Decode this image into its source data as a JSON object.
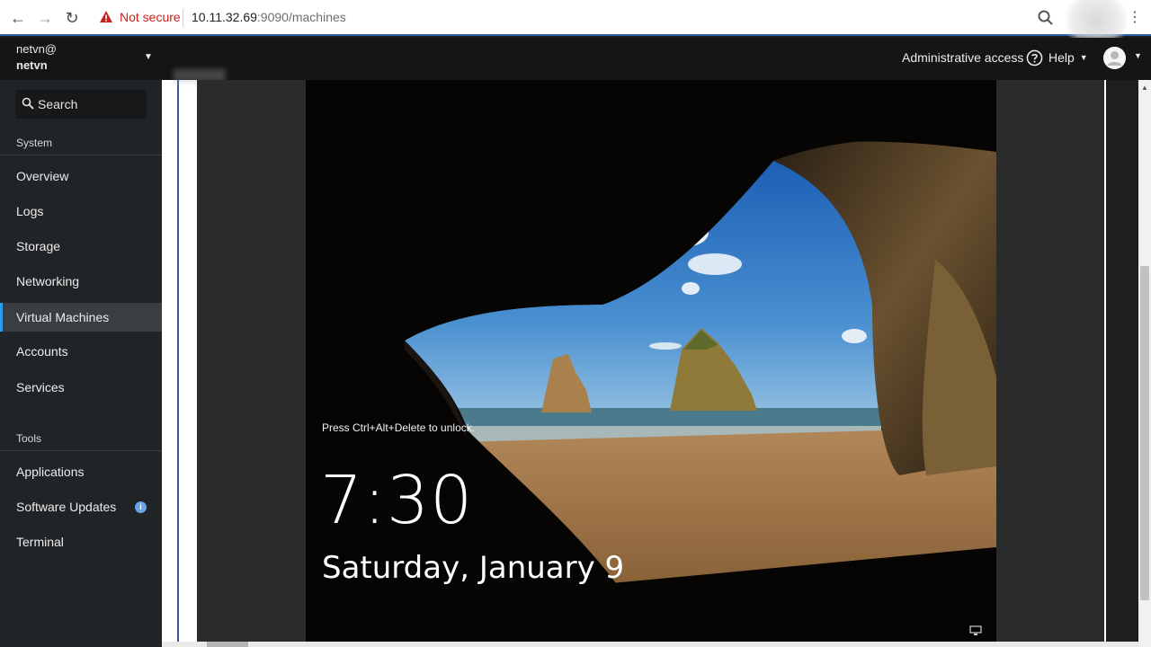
{
  "browser": {
    "security_label": "Not secure",
    "url_host": "10.11.32.69",
    "url_rest": ":9090/machines"
  },
  "header": {
    "host_user": "netvn@",
    "host_name": "netvn",
    "admin_access": "Administrative access",
    "help_label": "Help"
  },
  "sidebar": {
    "search_label": "Search",
    "system_section": "System",
    "tools_section": "Tools",
    "items": [
      {
        "label": "Overview"
      },
      {
        "label": "Logs"
      },
      {
        "label": "Storage"
      },
      {
        "label": "Networking"
      },
      {
        "label": "Virtual Machines",
        "active": true
      },
      {
        "label": "Accounts"
      },
      {
        "label": "Services"
      }
    ],
    "tools_items": [
      {
        "label": "Applications"
      },
      {
        "label": "Software Updates",
        "badge": "i"
      },
      {
        "label": "Terminal"
      }
    ]
  },
  "vm_console": {
    "unlock_hint": "Press Ctrl+Alt+Delete to unlock.",
    "time": "7:30",
    "date": "Saturday, January 9"
  },
  "colors": {
    "accent": "#2b9af3",
    "warning": "#c5221f",
    "sidebar_bg": "#212427",
    "header_bg": "#151515"
  },
  "icons": [
    "back-icon",
    "forward-icon",
    "reload-icon",
    "warning-icon",
    "zoom-icon",
    "kebab-icon",
    "help-icon",
    "avatar-icon",
    "search-icon",
    "info-icon",
    "network-icon"
  ]
}
